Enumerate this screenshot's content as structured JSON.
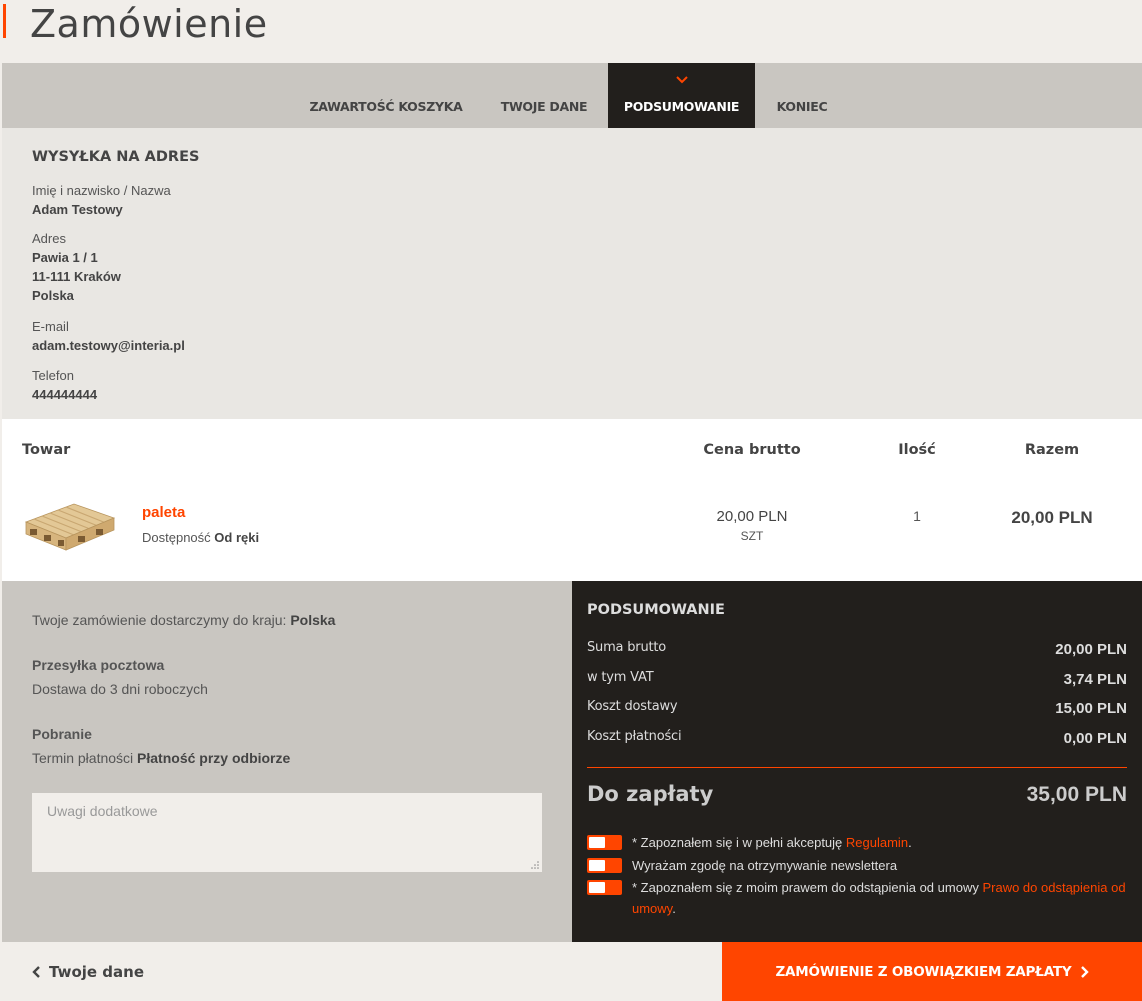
{
  "page": {
    "title": "Zamówienie"
  },
  "steps": [
    {
      "label": "ZAWARTOŚĆ KOSZYKA"
    },
    {
      "label": "TWOJE DANE"
    },
    {
      "label": "PODSUMOWANIE"
    },
    {
      "label": "KONIEC"
    }
  ],
  "shipping": {
    "heading": "WYSYŁKA NA ADRES",
    "name_label": "Imię i nazwisko / Nazwa",
    "name": "Adam Testowy",
    "address_label": "Adres",
    "street": "Pawia 1 / 1",
    "city": "11-111 Kraków",
    "country": "Polska",
    "email_label": "E-mail",
    "email": "adam.testowy@interia.pl",
    "phone_label": "Telefon",
    "phone": "444444444"
  },
  "products": {
    "headers": {
      "item": "Towar",
      "price": "Cena brutto",
      "qty": "Ilość",
      "total": "Razem"
    },
    "items": [
      {
        "name": "paleta",
        "availability_label": "Dostępność",
        "availability": "Od ręki",
        "price": "20,00 PLN",
        "unit": "SZT",
        "qty": "1",
        "total": "20,00 PLN"
      }
    ]
  },
  "delivery": {
    "country_text": "Twoje zamówienie dostarczymy do kraju:",
    "country": "Polska",
    "method_title": "Przesyłka pocztowa",
    "method_desc": "Dostawa do 3 dni roboczych",
    "payment_title": "Pobranie",
    "payment_term_label": "Termin płatności",
    "payment_term": "Płatność przy odbiorze",
    "notes_placeholder": "Uwagi dodatkowe"
  },
  "summary": {
    "heading": "PODSUMOWANIE",
    "rows": [
      {
        "label": "Suma brutto",
        "value": "20,00 PLN"
      },
      {
        "label": "w tym VAT",
        "value": "3,74 PLN"
      },
      {
        "label": "Koszt dostawy",
        "value": "15,00 PLN"
      },
      {
        "label": "Koszt płatności",
        "value": "0,00 PLN"
      }
    ],
    "to_pay_label": "Do zapłaty",
    "to_pay_value": "35,00 PLN",
    "agreements": [
      {
        "text": "* Zapoznałem się i w pełni akceptuję",
        "link": "Regulamin",
        "suffix": "."
      },
      {
        "text": "Wyrażam zgodę na otrzymywanie newslettera",
        "link": "",
        "suffix": ""
      },
      {
        "text": "* Zapoznałem się z moim prawem do odstąpienia od umowy",
        "link": "Prawo do odstąpienia od umowy",
        "suffix": "."
      }
    ]
  },
  "footer": {
    "back_label": "Twoje dane",
    "order_label": "ZAMÓWIENIE Z OBOWIĄZKIEM ZAPŁATY"
  },
  "colors": {
    "accent": "#ff4500",
    "dark": "#221f1c",
    "gray": "#c9c6c1",
    "light": "#e9e7e3"
  }
}
